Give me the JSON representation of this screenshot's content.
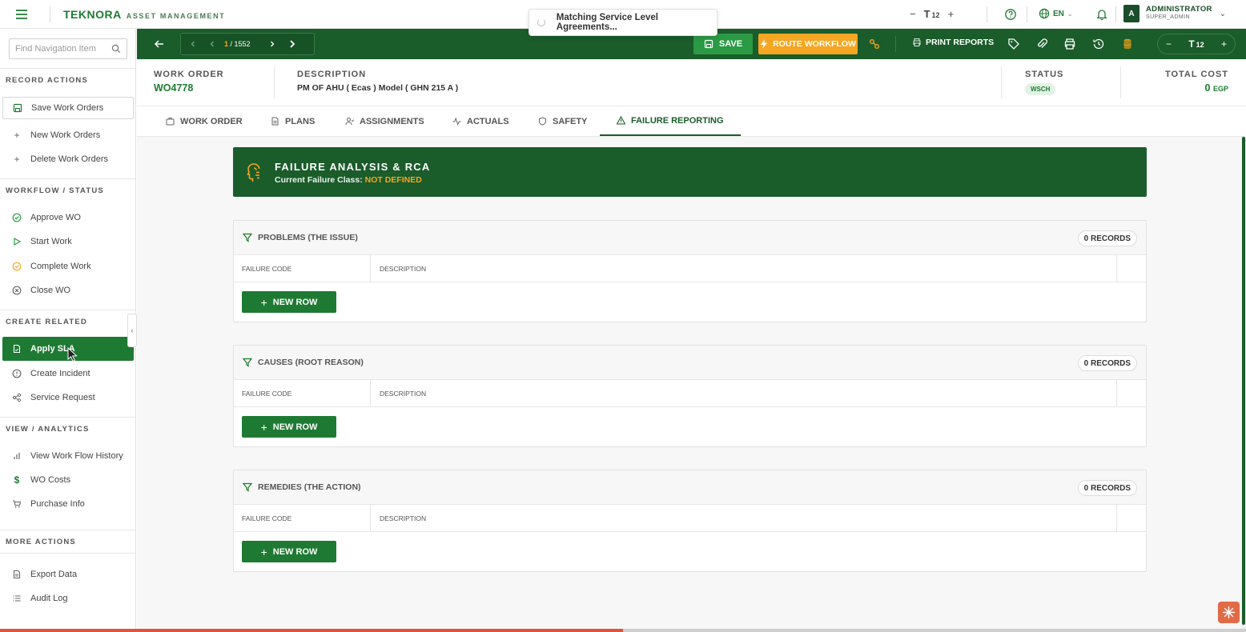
{
  "app": {
    "logo": "TEKNORA",
    "logo_sub": "ASSET MANAGEMENT",
    "toast": "Matching Service Level Agreements...",
    "font_size": "12",
    "lang": "EN",
    "user_name": "ADMINISTRATOR",
    "user_role": "SUPER_ADMIN",
    "avatar_letter": "A"
  },
  "sidebar": {
    "search_placeholder": "Find Navigation Item",
    "sections": {
      "record": "RECORD ACTIONS",
      "workflow": "WORKFLOW / STATUS",
      "create": "CREATE RELATED",
      "view": "VIEW / ANALYTICS",
      "more": "MORE ACTIONS"
    },
    "items": {
      "save": "Save Work Orders",
      "new": "New Work Orders",
      "delete": "Delete Work Orders",
      "approve": "Approve WO",
      "start": "Start Work",
      "complete": "Complete Work",
      "close": "Close WO",
      "apply_sla": "Apply SLA",
      "incident": "Create Incident",
      "service": "Service Request",
      "history": "View Work Flow History",
      "costs": "WO Costs",
      "purchase": "Purchase Info",
      "export": "Export Data",
      "audit": "Audit Log"
    }
  },
  "toolbar": {
    "page_current": "1",
    "page_total": "/ 1552",
    "save": "SAVE",
    "route": "ROUTE WORKFLOW",
    "print": "PRINT REPORTS",
    "font_size": "12"
  },
  "header": {
    "wo_label": "WORK ORDER",
    "wo_value": "WO4778",
    "desc_label": "DESCRIPTION",
    "desc_value": "PM OF AHU  ( Ecas ) Model ( GHN 215 A )",
    "status_label": "STATUS",
    "status_value": "WSCH",
    "cost_label": "TOTAL COST",
    "cost_value": "0",
    "cost_currency": "EGP"
  },
  "tabs": {
    "work_order": "WORK ORDER",
    "plans": "PLANS",
    "assignments": "ASSIGNMENTS",
    "actuals": "ACTUALS",
    "safety": "SAFETY",
    "failure": "FAILURE REPORTING"
  },
  "banner": {
    "title": "FAILURE ANALYSIS & RCA",
    "sub_label": "Current Failure Class:",
    "sub_value": "NOT DEFINED"
  },
  "panels": {
    "col_code": "FAILURE CODE",
    "col_desc": "DESCRIPTION",
    "new_row": "NEW ROW",
    "problems": {
      "title": "PROBLEMS (THE ISSUE)",
      "records": "0 RECORDS"
    },
    "causes": {
      "title": "CAUSES (ROOT REASON)",
      "records": "0 RECORDS"
    },
    "remedies": {
      "title": "REMEDIES (THE ACTION)",
      "records": "0 RECORDS"
    }
  },
  "colors": {
    "brand_green": "#1a5c2a",
    "accent_green": "#1e7a33",
    "accent_orange": "#f5a623"
  }
}
